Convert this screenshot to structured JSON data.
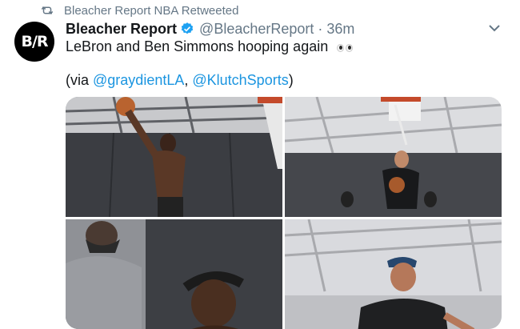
{
  "retweet": {
    "label": "Bleacher Report NBA Retweeted",
    "icon": "retweet-icon"
  },
  "author": {
    "avatar_text": "B/R",
    "display_name": "Bleacher Report",
    "verified": true,
    "handle": "@BleacherReport",
    "separator": "·",
    "time": "36m"
  },
  "tweet": {
    "line1": "LeBron and Ben Simmons hooping again",
    "line1_emoji": "eyes-emoji",
    "via_prefix": "(via ",
    "mention1": "@graydientLA",
    "comma": ", ",
    "mention2": "@KlutchSports",
    "via_suffix": ")"
  },
  "media": {
    "photos": [
      {
        "name": "photo-dunk-left",
        "description_icon": "basketball-player-photo"
      },
      {
        "name": "photo-dunk-right",
        "description_icon": "basketball-player-photo"
      },
      {
        "name": "photo-bandana-bottom-left",
        "description_icon": "basketball-player-photo"
      },
      {
        "name": "photo-player-bottom-right",
        "description_icon": "basketball-player-photo"
      }
    ]
  },
  "colors": {
    "link": "#1b95e0",
    "secondary_text": "#657786",
    "verified_badge": "#1da1f2"
  }
}
